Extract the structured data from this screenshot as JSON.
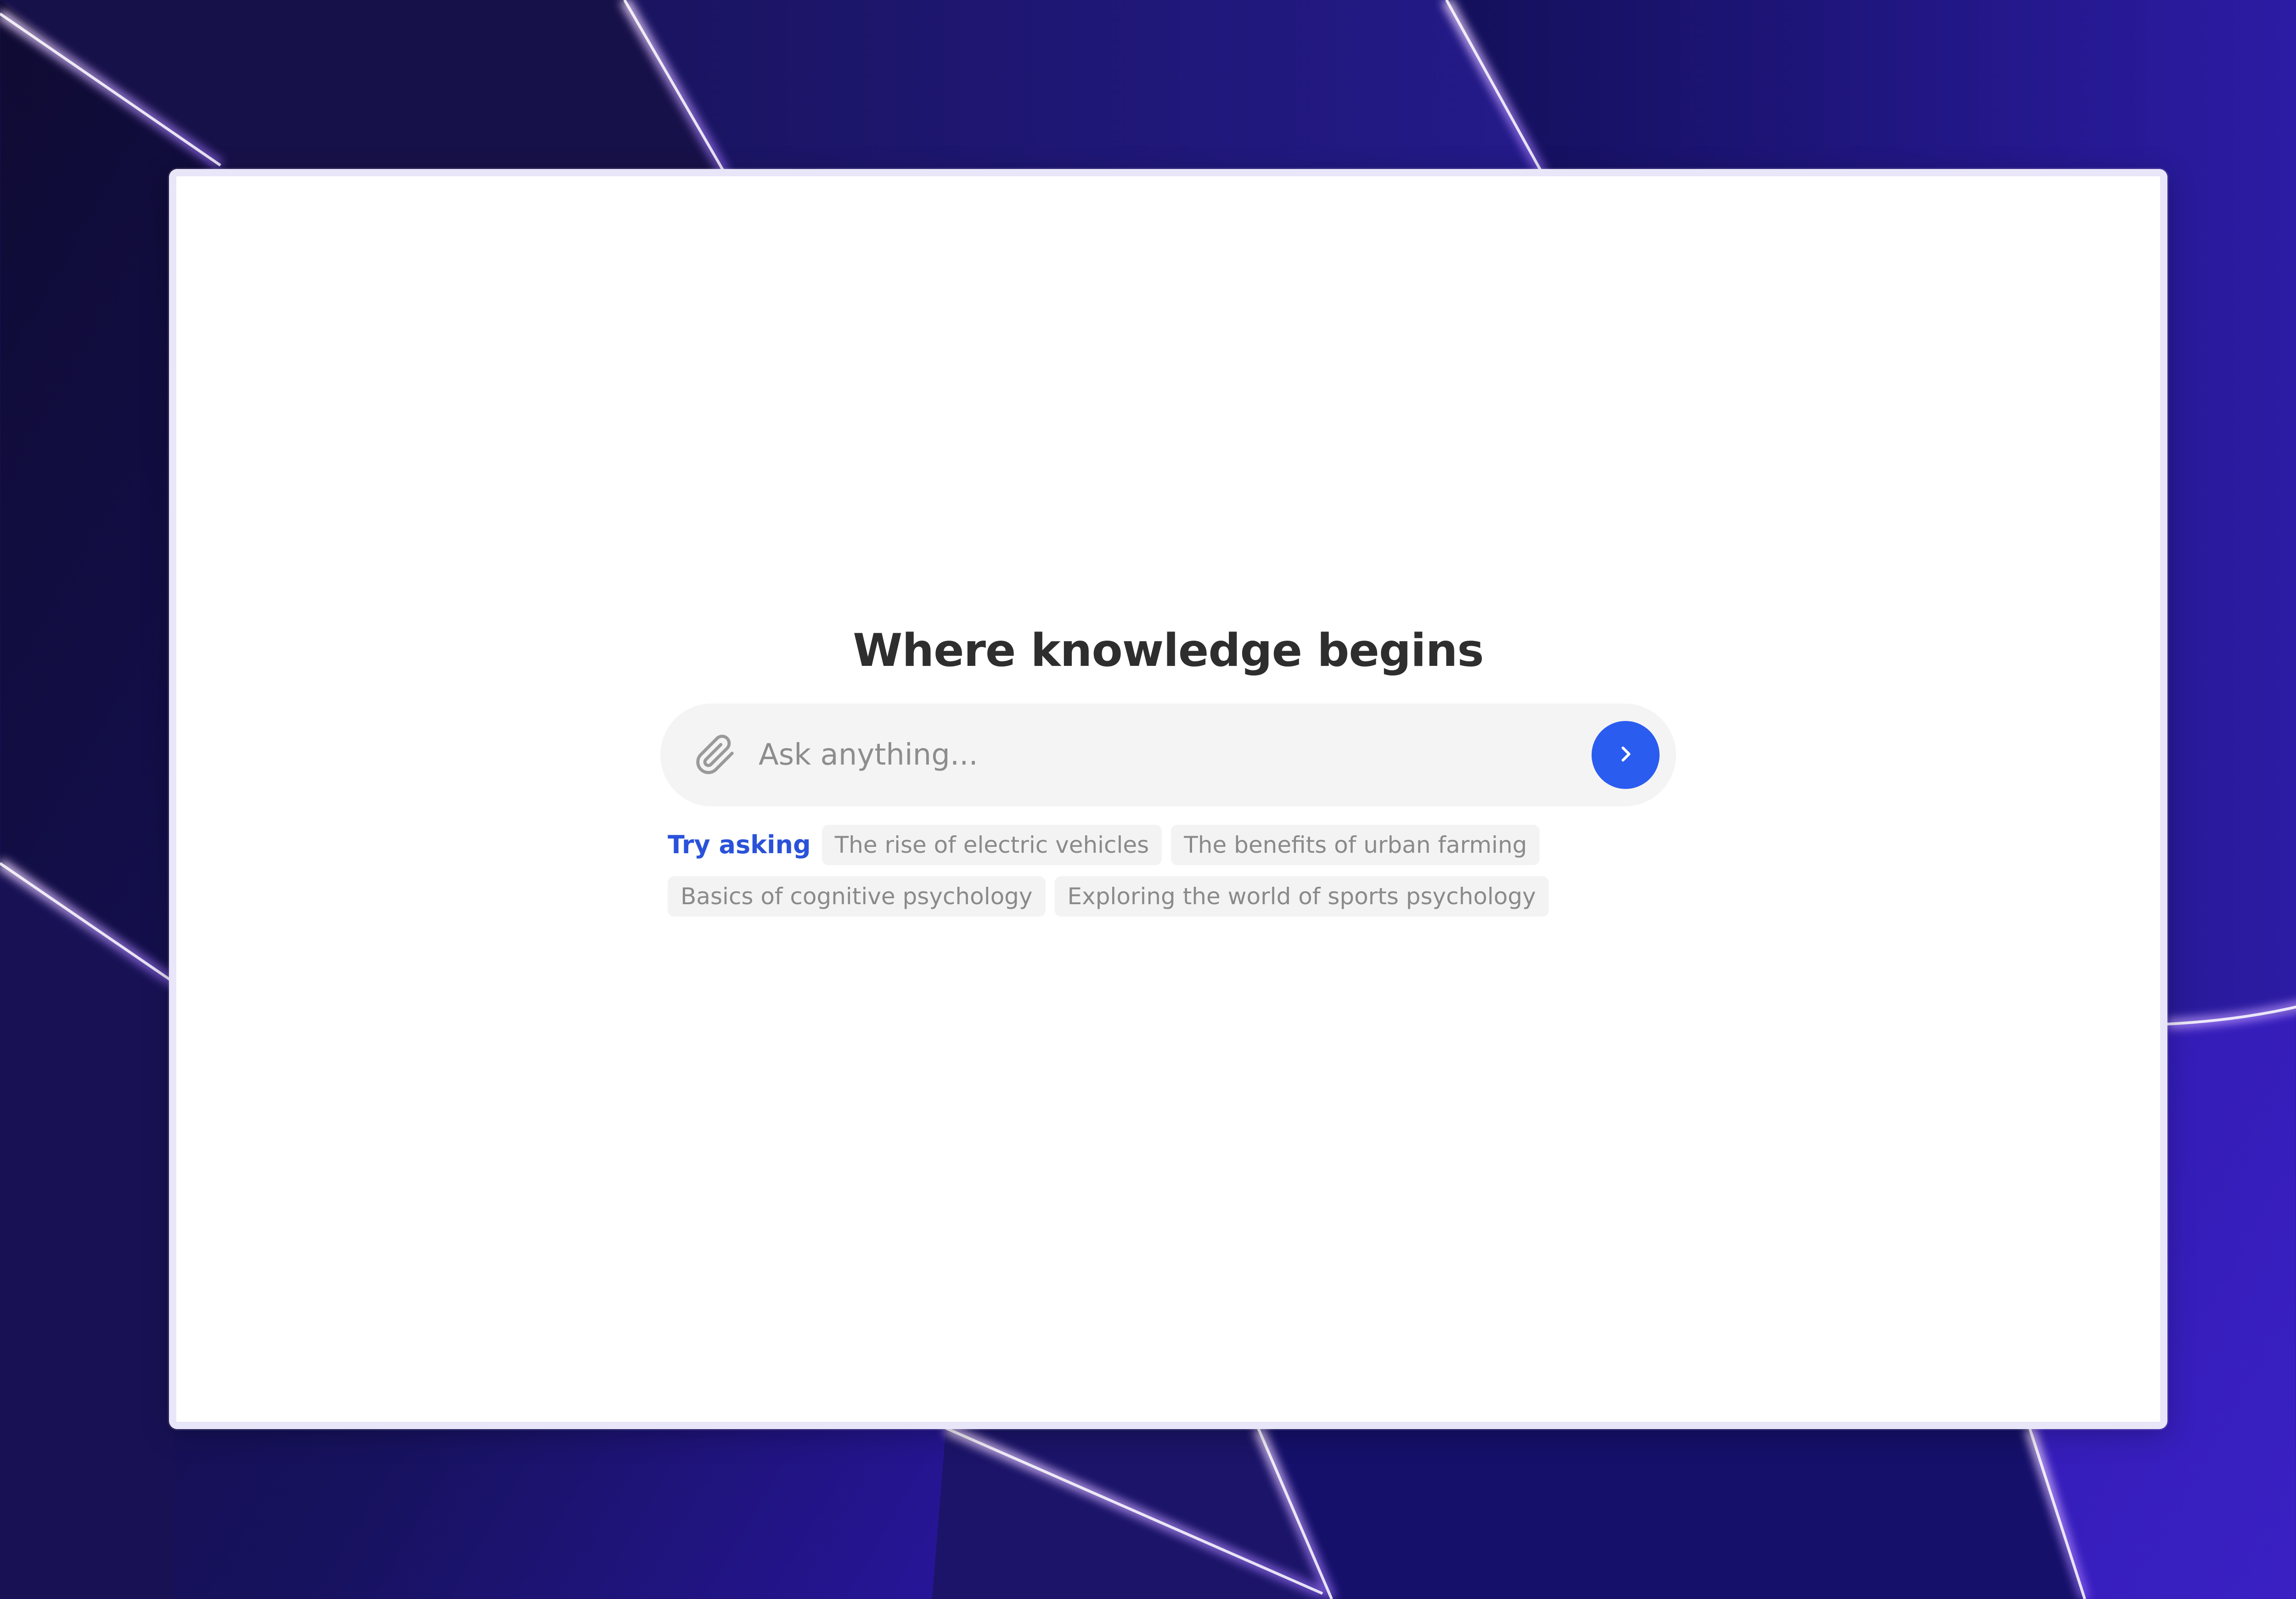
{
  "colors": {
    "accent": "#2b5cf0",
    "try_label": "#2a52d9",
    "headline": "#2e2e2e",
    "input_background": "#f4f4f4",
    "chip_background": "#f3f3f3",
    "chip_text": "#8a8a8a",
    "wallpaper_dark": "#0f0b33",
    "wallpaper_mid": "#17125e",
    "wallpaper_violet": "#3a20c3"
  },
  "main": {
    "headline": "Where knowledge begins"
  },
  "search": {
    "placeholder": "Ask anything...",
    "value": "",
    "attach_icon": "paperclip-icon",
    "submit_icon": "chevron-right-icon"
  },
  "suggestions": {
    "label": "Try asking",
    "items": [
      "The rise of electric vehicles",
      "The benefits of urban farming",
      "Basics of cognitive psychology",
      "Exploring the world of sports psychology"
    ]
  }
}
